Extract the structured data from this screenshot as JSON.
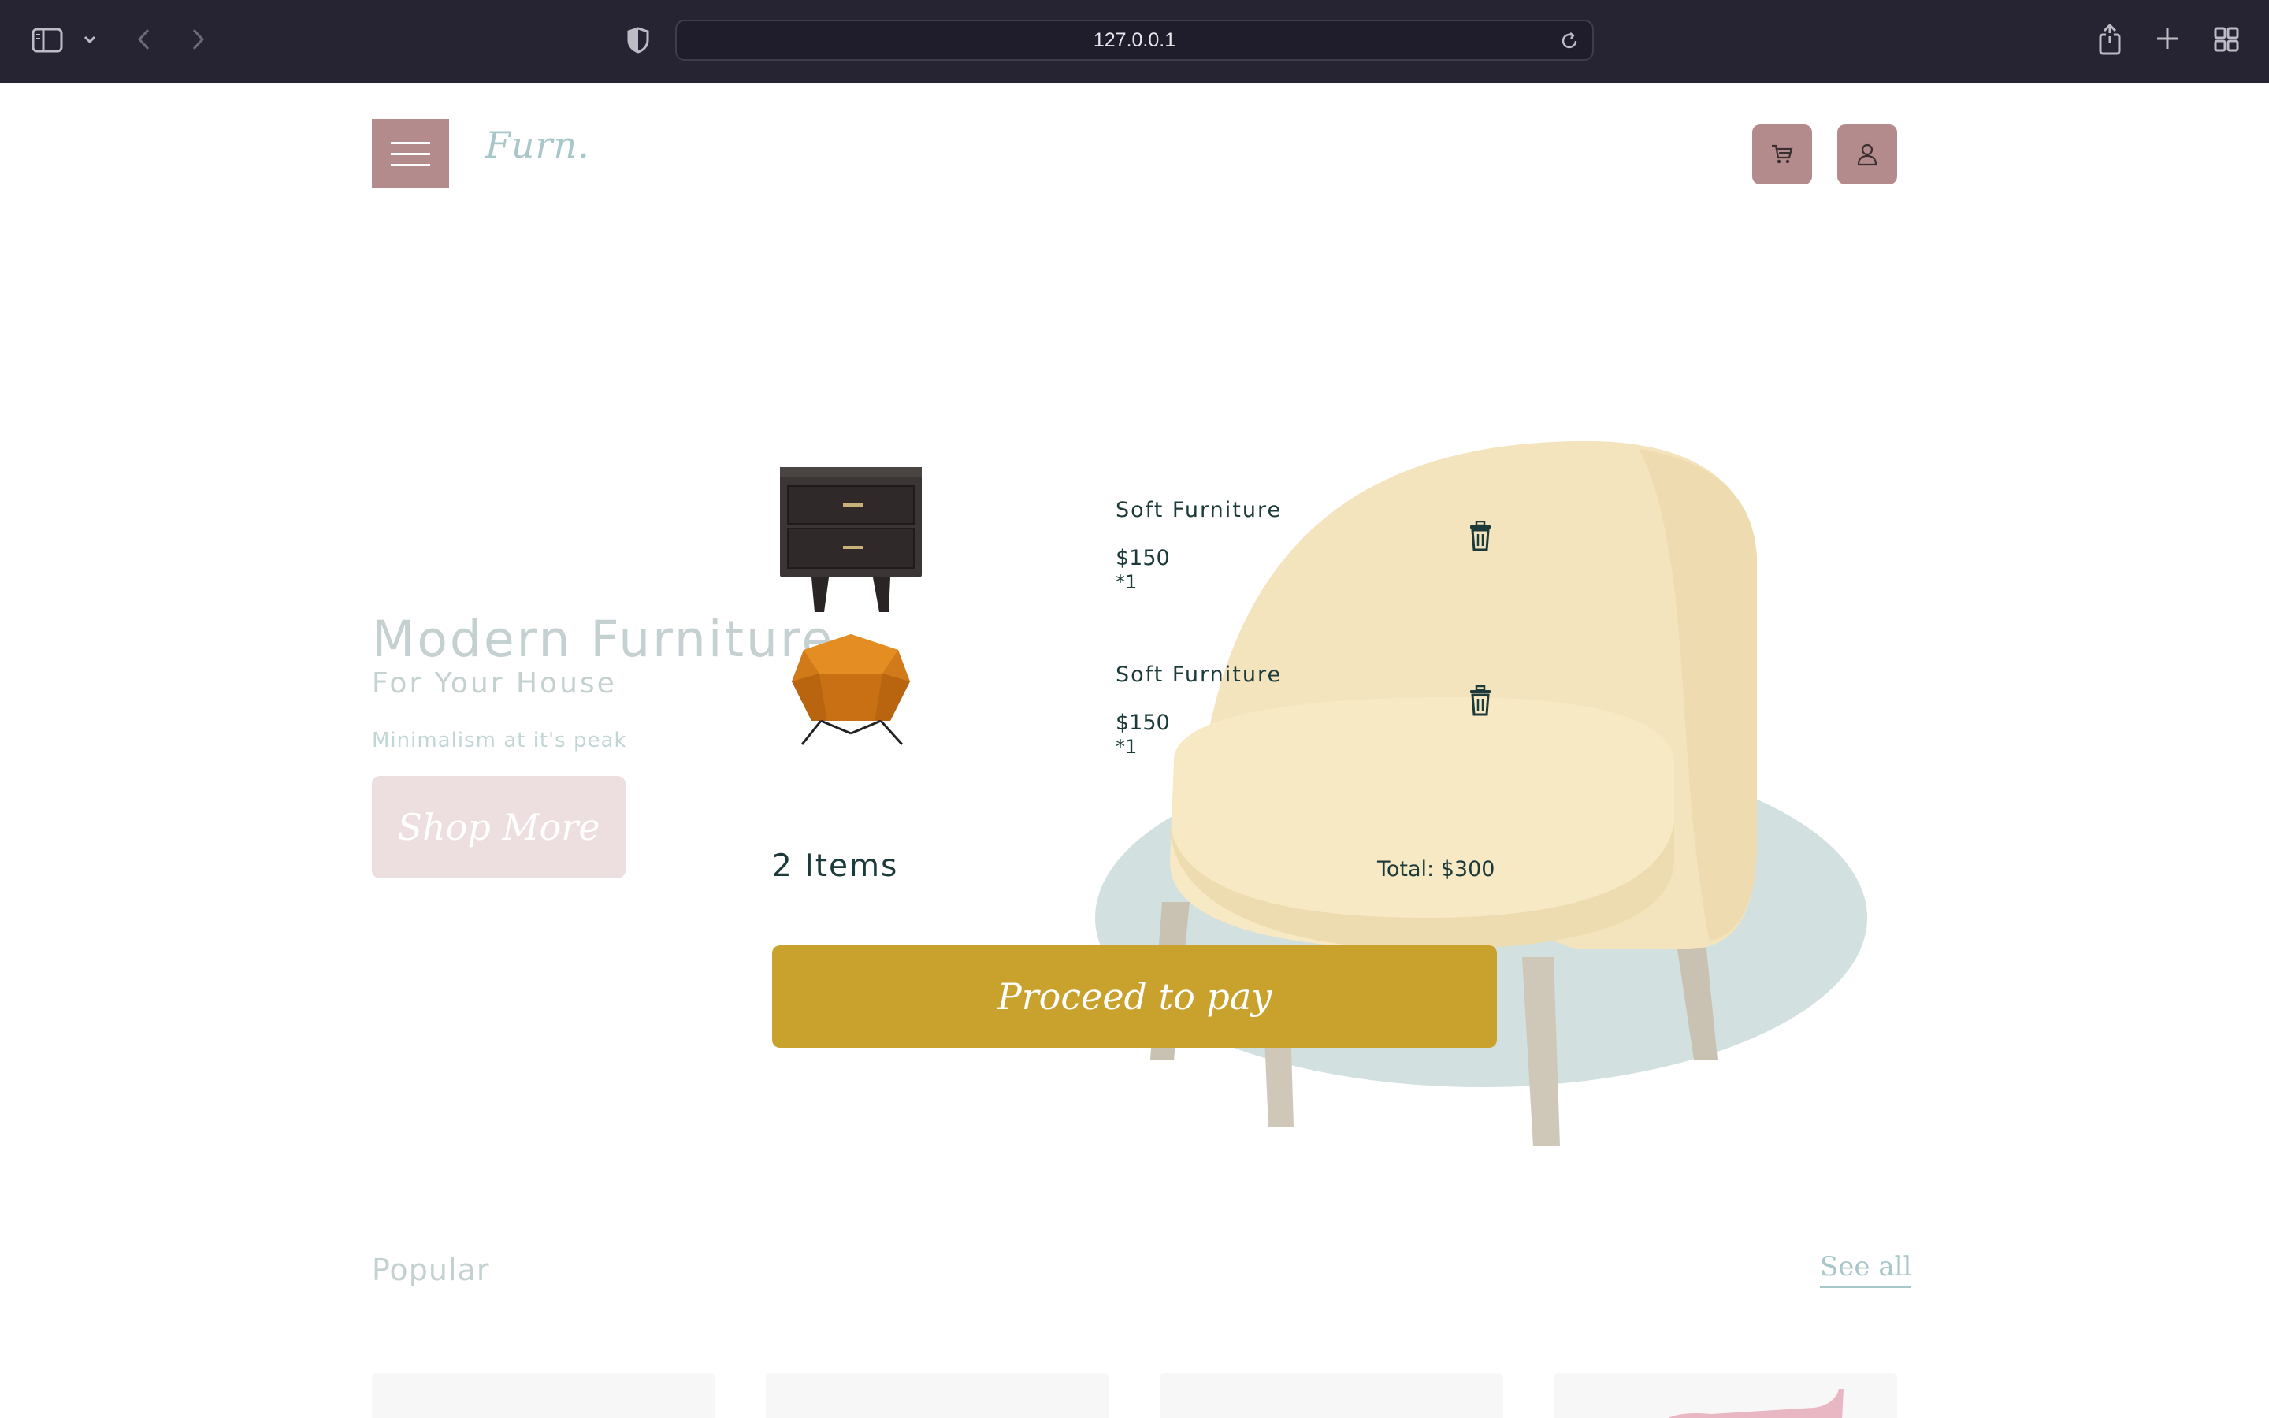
{
  "browser": {
    "url": "127.0.0.1",
    "icons": [
      "sidebar-icon",
      "chevron-down-icon",
      "back-icon",
      "forward-icon",
      "shield-icon",
      "reload-icon",
      "share-icon",
      "plus-icon",
      "tab-grid-icon"
    ]
  },
  "header": {
    "logo": "Furn.",
    "icons": [
      "menu-icon",
      "cart-icon",
      "user-icon"
    ]
  },
  "hero": {
    "title": "Modern Furniture",
    "subtitle": "For Your House",
    "tagline": "Minimalism at it's peak",
    "button_label": "Shop More"
  },
  "cart": {
    "items": [
      {
        "name": "Soft Furniture",
        "price": "$150",
        "quantity": "*1",
        "image": "nightstand"
      },
      {
        "name": "Soft Furniture",
        "price": "$150",
        "quantity": "*1",
        "image": "orange-armchair"
      }
    ],
    "count_label": "2 Items",
    "total_label": "Total: $300",
    "pay_label": "Proceed to pay"
  },
  "popular": {
    "title": "Popular",
    "see_all": "See all"
  },
  "colors": {
    "chrome": "#262433",
    "accent": "#b48b8d",
    "pay": "#c9a22e",
    "teal_text": "#1d3a3a"
  }
}
